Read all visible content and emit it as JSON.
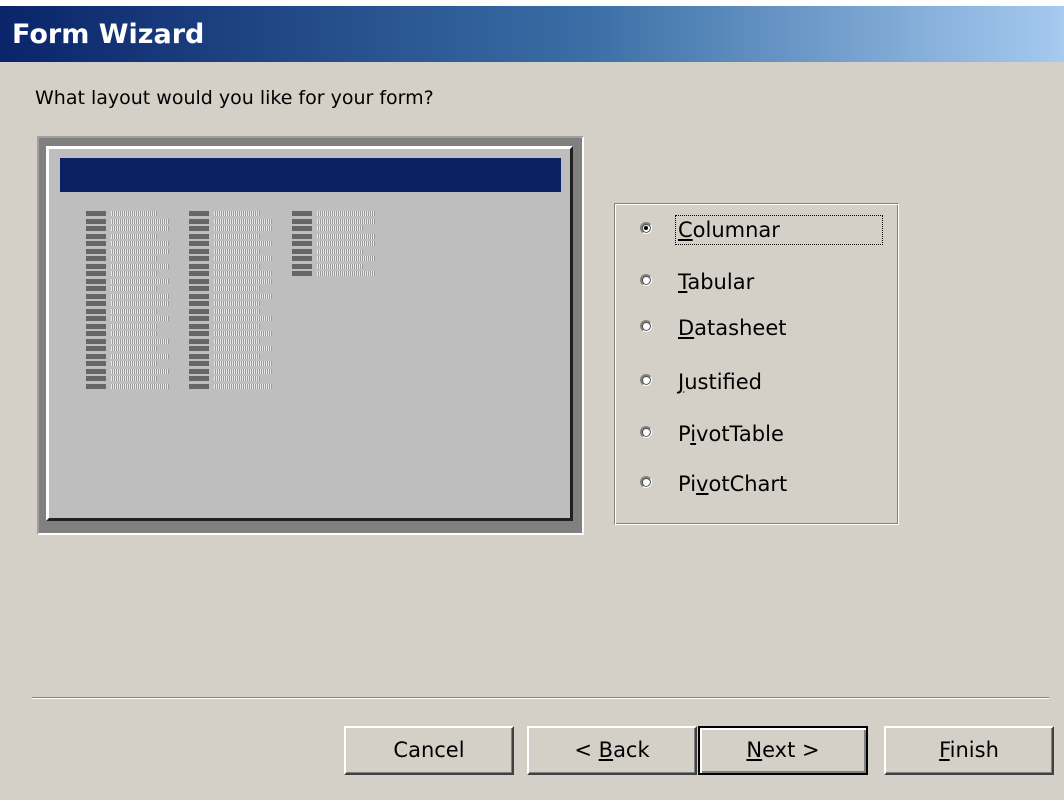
{
  "window": {
    "title": "Form Wizard"
  },
  "prompt": "What layout would you like for your form?",
  "layout_options": [
    {
      "pre": "",
      "acc": "C",
      "post": "olumnar",
      "selected": true
    },
    {
      "pre": "",
      "acc": "T",
      "post": "abular",
      "selected": false
    },
    {
      "pre": "",
      "acc": "D",
      "post": "atasheet",
      "selected": false
    },
    {
      "pre": "",
      "acc": "J",
      "post": "ustified",
      "selected": false
    },
    {
      "pre": "P",
      "acc": "i",
      "post": "votTable",
      "selected": false
    },
    {
      "pre": "Pi",
      "acc": "v",
      "post": "otChart",
      "selected": false
    }
  ],
  "buttons": {
    "cancel": {
      "pre": "Cancel",
      "acc": "",
      "post": ""
    },
    "back": {
      "pre": "< ",
      "acc": "B",
      "post": "ack"
    },
    "next": {
      "pre": "",
      "acc": "N",
      "post": "ext >"
    },
    "finish": {
      "pre": "",
      "acc": "F",
      "post": "inish"
    }
  },
  "colors": {
    "title_gradient_start": "#0a246a",
    "title_gradient_end": "#a6caf0",
    "face": "#d4d0c8",
    "preview_header": "#0a2262"
  }
}
